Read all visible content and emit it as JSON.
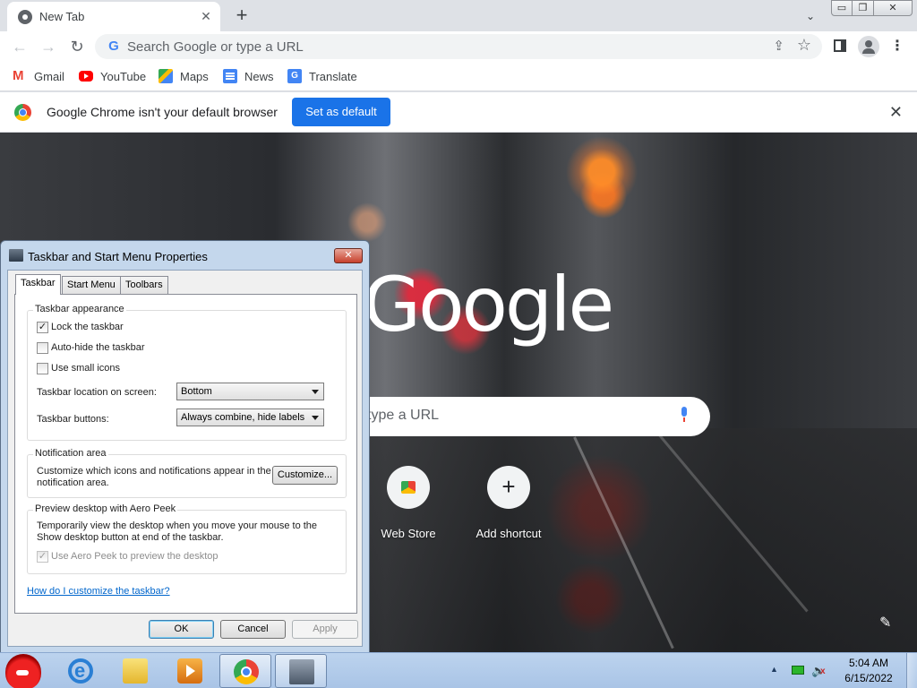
{
  "browser": {
    "tab": {
      "title": "New Tab",
      "close_glyph": "✕"
    },
    "new_tab_glyph": "+",
    "tab_search_glyph": "⌄",
    "window_controls": {
      "minimize": "▭",
      "maximize": "❐",
      "close": "✕"
    },
    "nav": {
      "back": "←",
      "forward": "→",
      "reload": "↻"
    },
    "omnibox": {
      "placeholder": "Search Google or type a URL",
      "g_glyph": "G"
    },
    "bookmarks": [
      {
        "label": "Gmail",
        "icon": "gmail-icon"
      },
      {
        "label": "YouTube",
        "icon": "youtube-icon"
      },
      {
        "label": "Maps",
        "icon": "maps-icon"
      },
      {
        "label": "News",
        "icon": "news-icon"
      },
      {
        "label": "Translate",
        "icon": "translate-icon"
      }
    ],
    "infobar": {
      "message": "Google Chrome isn't your default browser",
      "button": "Set as default",
      "close_glyph": "✕"
    }
  },
  "ntp": {
    "logo_text": "Google",
    "search_placeholder": "type a URL",
    "shortcuts": [
      {
        "label": "Web Store"
      },
      {
        "label": "Add shortcut",
        "glyph": "+"
      }
    ],
    "pencil_glyph": "✎"
  },
  "dialog": {
    "title": "Taskbar and Start Menu Properties",
    "close_glyph": "✕",
    "tabs": [
      "Taskbar",
      "Start Menu",
      "Toolbars"
    ],
    "appearance": {
      "title": "Taskbar appearance",
      "lock": {
        "label": "Lock the taskbar",
        "checked": true
      },
      "autohide": {
        "label": "Auto-hide the taskbar",
        "checked": false
      },
      "small_icons": {
        "label": "Use small icons",
        "checked": false
      },
      "location_label": "Taskbar location on screen:",
      "location_value": "Bottom",
      "buttons_label": "Taskbar buttons:",
      "buttons_value": "Always combine, hide labels"
    },
    "notification": {
      "title": "Notification area",
      "text": "Customize which icons and notifications appear in the notification area.",
      "button": "Customize..."
    },
    "aero": {
      "title": "Preview desktop with Aero Peek",
      "text": "Temporarily view the desktop when you move your mouse to the Show desktop button at end of the taskbar.",
      "checkbox": {
        "label": "Use Aero Peek to preview the desktop",
        "checked": true,
        "enabled": false
      }
    },
    "help_link": "How do I customize the taskbar?",
    "buttons": {
      "ok": "OK",
      "cancel": "Cancel",
      "apply": "Apply"
    },
    "check_glyph": "✓"
  },
  "taskbar": {
    "items": [
      "angry-birds-icon",
      "internet-explorer-icon",
      "file-explorer-icon",
      "media-player-icon",
      "chrome-icon",
      "taskbar-properties-icon"
    ],
    "tray": {
      "arrow_glyph": "▲",
      "volume_glyph": "🔈"
    },
    "clock": {
      "time": "5:04 AM",
      "date": "6/15/2022"
    }
  }
}
